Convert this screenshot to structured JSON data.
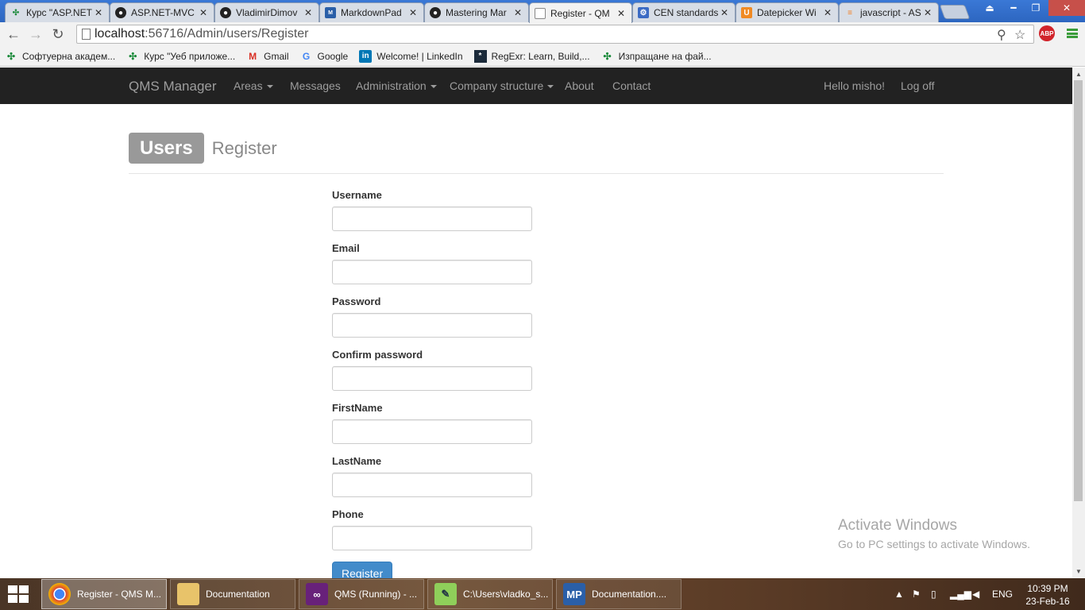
{
  "browser": {
    "tabs": [
      {
        "label": "Курс \"ASP.NET",
        "icon_color": "#1a8a3a",
        "icon": "academy-icon"
      },
      {
        "label": "ASP.NET-MVC",
        "icon_color": "#222222",
        "icon": "github-icon"
      },
      {
        "label": "VladimirDimov",
        "icon_color": "#222222",
        "icon": "github-icon"
      },
      {
        "label": "MarkdownPad",
        "icon_color": "#2a5fa8",
        "icon": "markdownpad-icon"
      },
      {
        "label": "Mastering Mar",
        "icon_color": "#222222",
        "icon": "github-icon"
      },
      {
        "label": "Register - QM",
        "icon_color": "#ffffff",
        "icon": "page-icon"
      },
      {
        "label": "CEN standards",
        "icon_color": "#3b6bc4",
        "icon": "cen-icon"
      },
      {
        "label": "Datepicker Wi",
        "icon_color": "#f08a24",
        "icon": "jqueryui-icon"
      },
      {
        "label": "javascript - AS",
        "icon_color": "#f48024",
        "icon": "stackoverflow-icon"
      }
    ],
    "address": {
      "host": "localhost",
      "path": ":56716/Admin/users/Register"
    },
    "adblock_label": "ABP",
    "bookmarks": [
      {
        "label": "Софтуерна академ...",
        "icon": "academy-icon",
        "color": "#1a8a3a"
      },
      {
        "label": "Курс \"Уеб приложе...",
        "icon": "academy-icon",
        "color": "#1a8a3a"
      },
      {
        "label": "Gmail",
        "icon": "gmail-icon",
        "color": "#d93025"
      },
      {
        "label": "Google",
        "icon": "google-icon",
        "color": "#4285f4"
      },
      {
        "label": "Welcome! | LinkedIn",
        "icon": "linkedin-icon",
        "color": "#0077b5"
      },
      {
        "label": "RegExr: Learn, Build,...",
        "icon": "regexr-icon",
        "color": "#1b2a3a"
      },
      {
        "label": "Изпращане на фай...",
        "icon": "academy-icon",
        "color": "#1a8a3a"
      }
    ]
  },
  "navbar": {
    "brand": "QMS Manager",
    "items": [
      {
        "label": "Areas",
        "dropdown": true
      },
      {
        "label": "Messages",
        "dropdown": false
      },
      {
        "label": "Administration",
        "dropdown": true
      },
      {
        "label": "Company structure",
        "dropdown": true
      },
      {
        "label": "About",
        "dropdown": false
      },
      {
        "label": "Contact",
        "dropdown": false
      }
    ],
    "greeting": "Hello misho!",
    "logoff": "Log off"
  },
  "header": {
    "badge": "Users",
    "subtitle": "Register"
  },
  "form": {
    "fields": [
      {
        "label": "Username",
        "value": ""
      },
      {
        "label": "Email",
        "value": ""
      },
      {
        "label": "Password",
        "value": ""
      },
      {
        "label": "Confirm password",
        "value": ""
      },
      {
        "label": "FirstName",
        "value": ""
      },
      {
        "label": "LastName",
        "value": ""
      },
      {
        "label": "Phone",
        "value": ""
      }
    ],
    "submit_label": "Register"
  },
  "watermark": {
    "line1": "Activate Windows",
    "line2": "Go to PC settings to activate Windows."
  },
  "taskbar": {
    "items": [
      {
        "label": "Register - QMS M...",
        "icon": "chrome-icon",
        "active": true
      },
      {
        "label": "Documentation",
        "icon": "folder-icon",
        "active": false
      },
      {
        "label": "QMS (Running) - ...",
        "icon": "visual-studio-icon",
        "active": false
      },
      {
        "label": "C:\\Users\\vladko_s...",
        "icon": "notepadpp-icon",
        "active": false
      },
      {
        "label": "Documentation....",
        "icon": "markdownpad-icon",
        "active": false
      }
    ],
    "language": "ENG",
    "time": "10:39 PM",
    "date": "23-Feb-16"
  }
}
